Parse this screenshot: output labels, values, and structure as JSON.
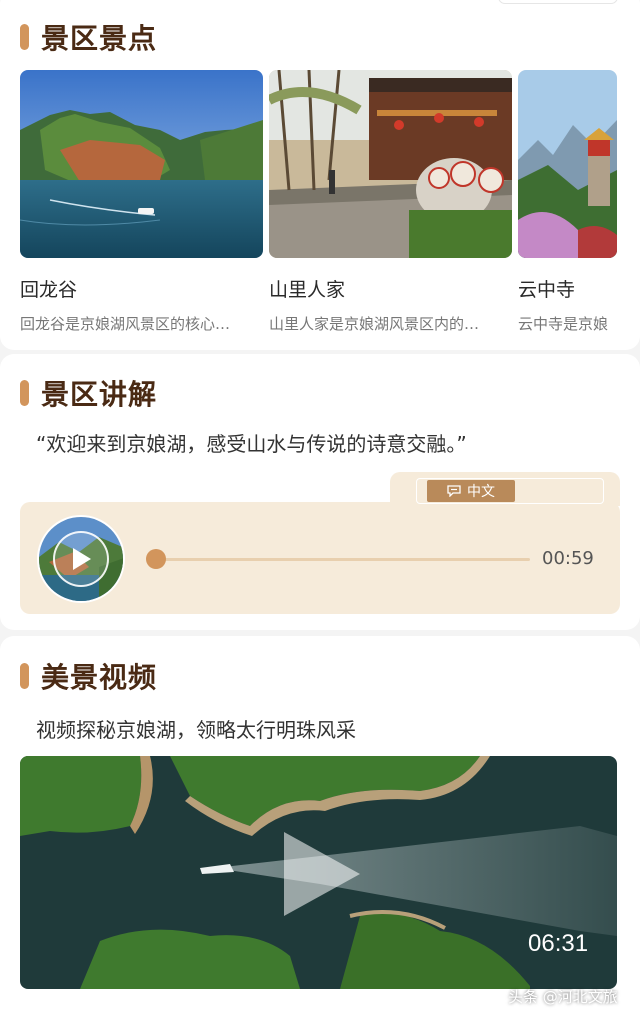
{
  "spots_section": {
    "title": "景区景点",
    "items": [
      {
        "name": "回龙谷",
        "desc": "回龙谷是京娘湖风景区的核心…"
      },
      {
        "name": "山里人家",
        "desc": "山里人家是京娘湖风景区内的…"
      },
      {
        "name": "云中寺",
        "desc": "云中寺是京娘"
      }
    ]
  },
  "audio_section": {
    "title": "景区讲解",
    "quote": "“欢迎来到京娘湖，感受山水与传说的诗意交融。”",
    "language": "中文",
    "duration": "00:59",
    "progress": 0
  },
  "video_section": {
    "title": "美景视频",
    "subtitle": "视频探秘京娘湖，领略太行明珠风采",
    "duration": "06:31"
  },
  "watermark": "头条 @河北文旅",
  "colors": {
    "accent": "#d2955c",
    "title_brown": "#4a2a14",
    "audio_bg": "#f6ebda",
    "lang_btn": "#b98a5a"
  }
}
